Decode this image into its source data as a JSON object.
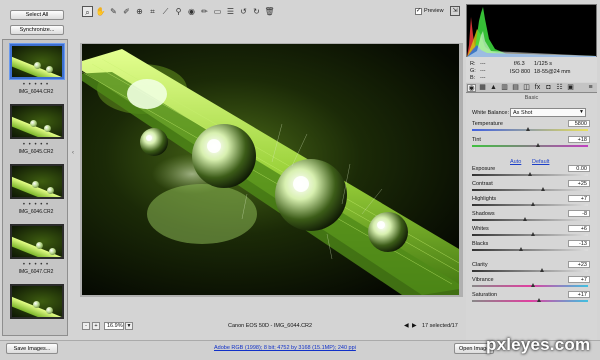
{
  "filmstrip": {
    "select_all": "Select All",
    "synchronize": "Synchronize...",
    "items": [
      {
        "dots": "• • • • •",
        "name": "IMG_6044.CR2"
      },
      {
        "dots": "• • • • •",
        "name": "IMG_6045.CR2"
      },
      {
        "dots": "• • • • •",
        "name": "IMG_6046.CR2"
      },
      {
        "dots": "• • • • •",
        "name": "IMG_6047.CR2"
      },
      {
        "dots": "",
        "name": ""
      }
    ]
  },
  "toolbar": {
    "preview_label": "Preview",
    "preview_check": "✓",
    "icons": [
      "zoom-tool",
      "hand-tool",
      "white-balance-tool",
      "color-sampler-tool",
      "targeted-adjustment-tool",
      "crop-tool",
      "straighten-tool",
      "spot-removal-tool",
      "red-eye-tool",
      "adjustment-brush-tool",
      "graduated-filter-tool",
      "preferences",
      "rotate-left",
      "rotate-right",
      "trash"
    ]
  },
  "camera": {
    "r": "R:",
    "g": "G:",
    "b": "B:",
    "r_val": "---",
    "g_val": "---",
    "b_val": "---",
    "aperture": "f/6.3",
    "shutter": "1/125 s",
    "iso": "ISO 800",
    "lens": "18-55@24 mm"
  },
  "panel": {
    "title": "Basic",
    "wb_label": "White Balance:",
    "wb_value": "As Shot",
    "auto": "Auto",
    "default": "Default",
    "sliders": [
      {
        "label": "Temperature",
        "value": "5800",
        "pos": 0.49
      },
      {
        "label": "Tint",
        "value": "+18",
        "pos": 0.57
      },
      {
        "label": "Exposure",
        "value": "0.00",
        "pos": 0.5
      },
      {
        "label": "Contrast",
        "value": "+25",
        "pos": 0.62
      },
      {
        "label": "Highlights",
        "value": "+7",
        "pos": 0.53
      },
      {
        "label": "Shadows",
        "value": "-8",
        "pos": 0.46
      },
      {
        "label": "Whites",
        "value": "+6",
        "pos": 0.53
      },
      {
        "label": "Blacks",
        "value": "-13",
        "pos": 0.43
      },
      {
        "label": "Clarity",
        "value": "+23",
        "pos": 0.61
      },
      {
        "label": "Vibrance",
        "value": "+7",
        "pos": 0.53
      },
      {
        "label": "Saturation",
        "value": "+17",
        "pos": 0.58
      }
    ]
  },
  "status": {
    "zoom": "16.9%",
    "filename": "Canon EOS 50D  -  IMG_6044.CR2",
    "selected": "17 selected/17"
  },
  "bottom": {
    "save": "Save Images...",
    "workflow": "Adobe RGB (1998); 8 bit; 4752 by 3168 (15.1MP); 240 ppi",
    "open": "Open Image",
    "watermark": "pxleyes.com"
  },
  "colors": {
    "accent": "#3d6fd0",
    "panel": "#d6d6d6"
  }
}
